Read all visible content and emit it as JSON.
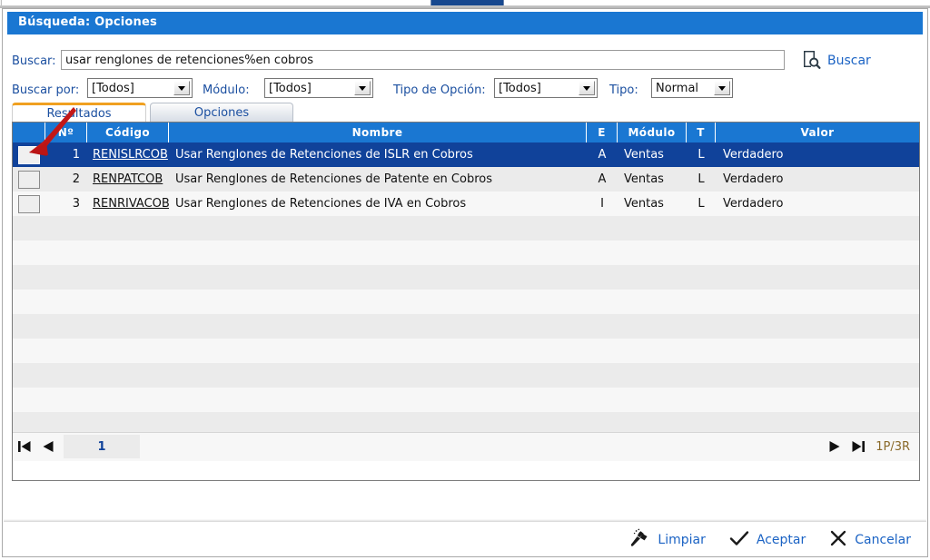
{
  "window": {
    "title": "Búsqueda: Opciones"
  },
  "search": {
    "label": "Buscar:",
    "value": "usar renglones de retenciones%en cobros",
    "placeholder": "",
    "button_label": "Buscar",
    "button_icon": "document-search-icon"
  },
  "filters": [
    {
      "label": "Buscar por:",
      "value": "[Todos]",
      "name": "buscar-por"
    },
    {
      "label": "Módulo:",
      "value": "[Todos]",
      "name": "modulo"
    },
    {
      "label": "Tipo de Opción:",
      "value": "[Todos]",
      "name": "tipo-de-opcion"
    },
    {
      "label": "Tipo:",
      "value": "Normal",
      "name": "tipo"
    }
  ],
  "tabs": [
    {
      "label": "Resultados",
      "active": true
    },
    {
      "label": "Opciones",
      "active": false
    }
  ],
  "grid": {
    "columns": [
      "",
      "Nº",
      "Código",
      "Nombre",
      "E",
      "Módulo",
      "T",
      "Valor"
    ],
    "rows": [
      {
        "num": "1",
        "codigo": "RENISLRCOB",
        "nombre": "Usar Renglones de Retenciones de ISLR en Cobros",
        "e": "A",
        "modulo": "Ventas",
        "t": "L",
        "valor": "Verdadero",
        "selected": true
      },
      {
        "num": "2",
        "codigo": "RENPATCOB",
        "nombre": "Usar Renglones de Retenciones de Patente en Cobros",
        "e": "A",
        "modulo": "Ventas",
        "t": "L",
        "valor": "Verdadero",
        "selected": false
      },
      {
        "num": "3",
        "codigo": "RENRIVACOB",
        "nombre": "Usar Renglones de Retenciones de IVA en Cobros",
        "e": "I",
        "modulo": "Ventas",
        "t": "L",
        "valor": "Verdadero",
        "selected": false
      }
    ],
    "empty_row_count": 10
  },
  "pager": {
    "first_icon": "first-page-icon",
    "prev_icon": "previous-page-icon",
    "next_icon": "next-page-icon",
    "last_icon": "last-page-icon",
    "current_page": "1",
    "count_label": "1P/3R"
  },
  "footer": {
    "buttons": [
      {
        "label": "Limpiar",
        "icon": "broom-icon",
        "name": "limpiar-button"
      },
      {
        "label": "Aceptar",
        "icon": "check-icon",
        "name": "aceptar-button"
      },
      {
        "label": "Cancelar",
        "icon": "close-x-icon",
        "name": "cancelar-button"
      }
    ]
  },
  "annotation": {
    "type": "red-arrow",
    "points_at": "first-row-checkbox",
    "color": "#cc1111"
  },
  "colors": {
    "title_bar": "#1a77d2",
    "grid_header": "#1a77d2",
    "selected_row": "#10429a",
    "link_blue": "#1b63c4",
    "label_blue": "#1b4fa0",
    "active_tab_accent": "#f0a020",
    "annotation_red": "#cc1111"
  }
}
